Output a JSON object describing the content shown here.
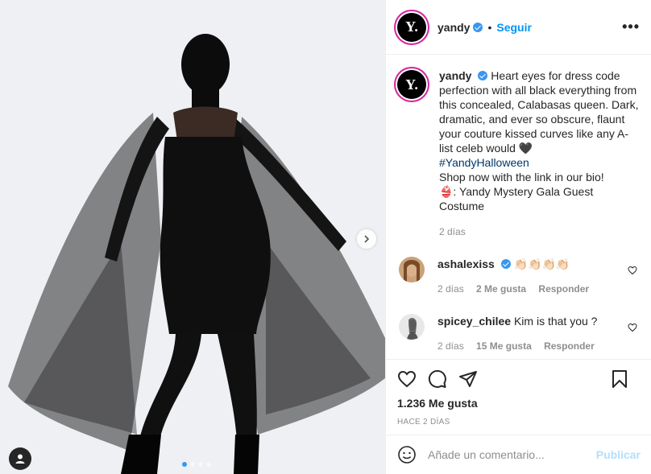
{
  "post": {
    "username": "yandy",
    "follow_label": "Seguir",
    "separator": "•",
    "more_label": "•••",
    "avatar_letter": "Y."
  },
  "caption": {
    "username": "yandy",
    "text_before_tag": "Heart eyes for dress code perfection with all black everything from this concealed, Calabasas queen. Dark, dramatic, and ever so obscure, flaunt your couture kissed curves like any A-list celeb would 🖤",
    "hashtag": "#YandyHalloween",
    "text_after_tag": "Shop now with the link in our bio!",
    "product_line": "👙: Yandy Mystery Gala Guest Costume",
    "time": "2 días"
  },
  "comments": [
    {
      "username": "ashalexiss",
      "verified": true,
      "text": "👏🏻👏🏻👏🏻👏🏻",
      "time": "2 días",
      "likes": "2 Me gusta",
      "reply": "Responder"
    },
    {
      "username": "spicey_chilee",
      "verified": false,
      "text": "Kim is that you ?",
      "time": "2 días",
      "likes": "15 Me gusta",
      "reply": "Responder"
    }
  ],
  "actions": {
    "likes": "1.236 Me gusta",
    "ago": "HACE 2 DÍAS",
    "icons": [
      "heart-icon",
      "comment-icon",
      "share-icon",
      "bookmark-icon"
    ]
  },
  "add_comment": {
    "placeholder": "Añade un comentario...",
    "post_label": "Publicar"
  },
  "carousel": {
    "slides": 4,
    "active": 1
  },
  "colors": {
    "accent": "#0095f6",
    "verified": "#3897f0",
    "muted": "#8e8e8e",
    "post_disabled": "#b2dffc"
  }
}
